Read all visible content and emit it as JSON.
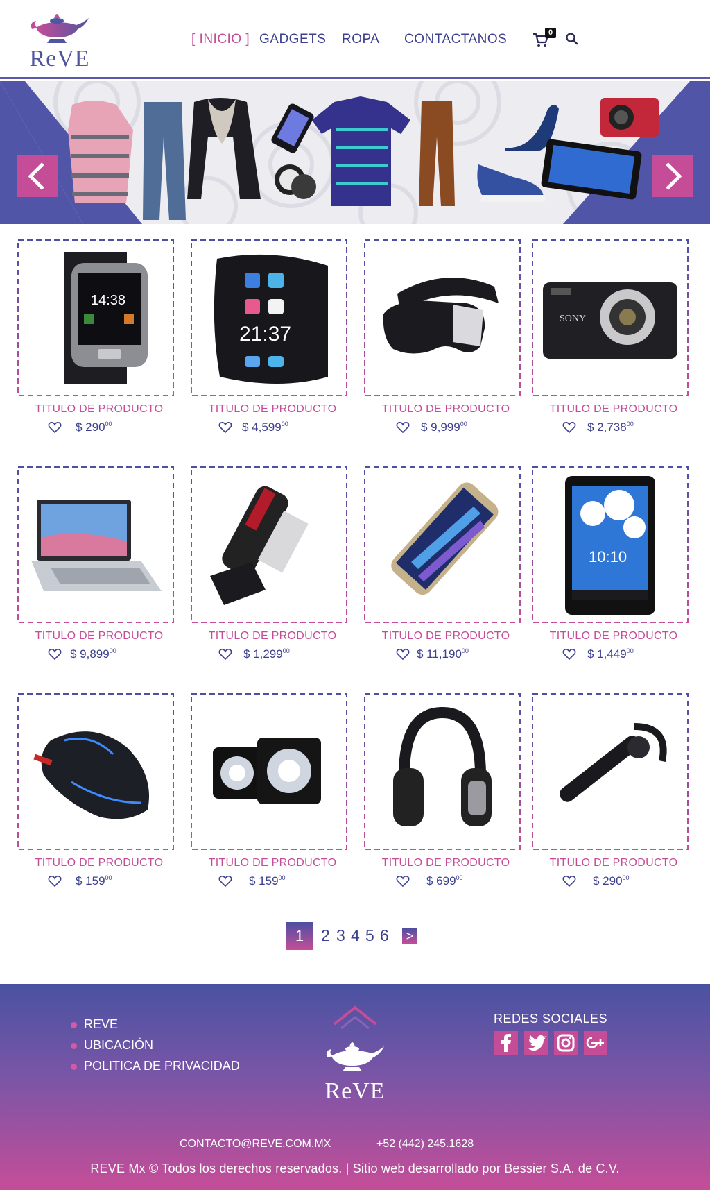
{
  "brand": {
    "name": "REVE",
    "name_display": "ReVE",
    "accent": "#c54d98",
    "primary": "#3d3f8f"
  },
  "nav": {
    "items": [
      {
        "label": "[ INICIO ]",
        "active": true
      },
      {
        "label": "GADGETS",
        "active": false
      },
      {
        "label": "ROPA",
        "active": false
      },
      {
        "label": "CONTACTANOS",
        "active": false
      }
    ],
    "cart_icon": "cart-icon",
    "cart_count": "0",
    "search_icon": "search-icon"
  },
  "hero": {
    "prev_icon": "chevron-left-icon",
    "next_icon": "chevron-right-icon"
  },
  "products": [
    {
      "title": "TITULO DE PRODUCTO",
      "price": "$ 290",
      "cents": "00",
      "image": "smartwatch"
    },
    {
      "title": "TITULO DE PRODUCTO",
      "price": "$ 4,599",
      "cents": "00",
      "image": "flexible-phone"
    },
    {
      "title": "TITULO DE PRODUCTO",
      "price": "$ 9,999",
      "cents": "00",
      "image": "vr-headset"
    },
    {
      "title": "TITULO DE PRODUCTO",
      "price": "$ 2,738",
      "cents": "00",
      "image": "camera"
    },
    {
      "title": "TITULO DE PRODUCTO",
      "price": "$ 9,899",
      "cents": "00",
      "image": "laptop"
    },
    {
      "title": "TITULO DE PRODUCTO",
      "price": "$ 1,299",
      "cents": "00",
      "image": "usb-drive"
    },
    {
      "title": "TITULO DE PRODUCTO",
      "price": "$ 11,190",
      "cents": "00",
      "image": "smartphone"
    },
    {
      "title": "TITULO DE PRODUCTO",
      "price": "$ 1,449",
      "cents": "00",
      "image": "tablet"
    },
    {
      "title": "TITULO DE PRODUCTO",
      "price": "$ 159",
      "cents": "00",
      "image": "gaming-mouse"
    },
    {
      "title": "TITULO DE PRODUCTO",
      "price": "$ 159",
      "cents": "00",
      "image": "speakers"
    },
    {
      "title": "TITULO DE PRODUCTO",
      "price": "$ 699",
      "cents": "00",
      "image": "headphones"
    },
    {
      "title": "TITULO DE PRODUCTO",
      "price": "$ 290",
      "cents": "00",
      "image": "bluetooth-headset"
    }
  ],
  "pagination": {
    "current": "1",
    "pages": [
      "2",
      "3",
      "4",
      "5",
      "6"
    ],
    "next_label": ">"
  },
  "footer": {
    "links": [
      "REVE",
      "UBICACIÓN",
      "POLITICA DE PRIVACIDAD"
    ],
    "logo_text": "ReVE",
    "social_title": "REDES SOCIALES",
    "social": [
      "facebook-icon",
      "twitter-icon",
      "instagram-icon",
      "google-plus-icon"
    ],
    "email": "CONTACTO@REVE.COM.MX",
    "phone": "+52 (442) 245.1628",
    "copyright": "REVE Mx © Todos los derechos reservados. | Sitio web desarrollado por Bessier S.A. de C.V."
  }
}
